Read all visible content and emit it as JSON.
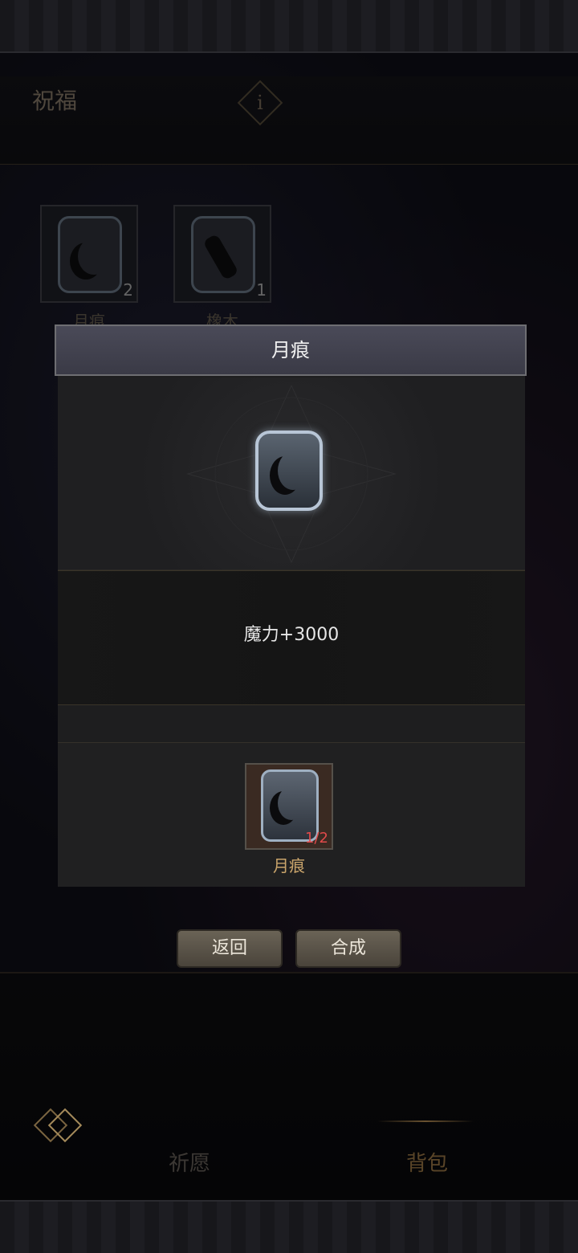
{
  "header": {
    "title": "祝福"
  },
  "inventory": [
    {
      "name": "月痕",
      "count": "2"
    },
    {
      "name": "橡木",
      "count": "1"
    }
  ],
  "dialog": {
    "title": "月痕",
    "stat": "魔力+3000",
    "material": {
      "name": "月痕",
      "count": "1/2"
    }
  },
  "buttons": {
    "back": "返回",
    "craft": "合成"
  },
  "nav": {
    "tab1": "祈愿",
    "tab2": "背包"
  },
  "colors": {
    "accent_gold": "#c9a46b",
    "count_red": "#e04a4a",
    "button_face": "#5a5348"
  }
}
